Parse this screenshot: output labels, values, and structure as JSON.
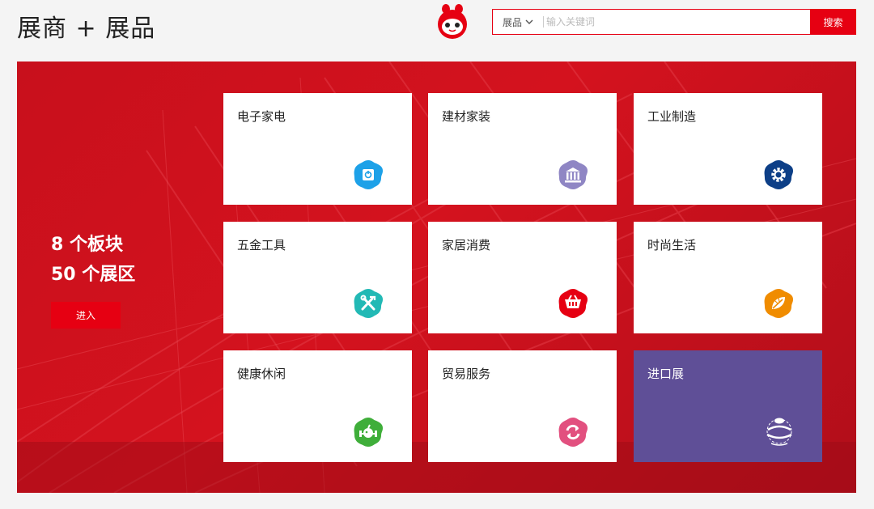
{
  "header": {
    "title": "展商 + 展品",
    "search": {
      "category": "展品",
      "placeholder": "输入关键词",
      "button_label": "搜索"
    }
  },
  "banner": {
    "stats_line1": "8 个板块",
    "stats_line2": "50 个展区",
    "enter_label": "进入"
  },
  "tiles": [
    {
      "label": "电子家电",
      "icon": "electronics-icon",
      "color": "#1da1e8"
    },
    {
      "label": "建材家装",
      "icon": "building-icon",
      "color": "#8f86c4"
    },
    {
      "label": "工业制造",
      "icon": "gear-icon",
      "color": "#0d3f87"
    },
    {
      "label": "五金工具",
      "icon": "tools-icon",
      "color": "#22b9b5"
    },
    {
      "label": "家居消费",
      "icon": "basket-icon",
      "color": "#e60012"
    },
    {
      "label": "时尚生活",
      "icon": "leaf-icon",
      "color": "#f08c00"
    },
    {
      "label": "健康休闲",
      "icon": "fitness-icon",
      "color": "#3fae3a"
    },
    {
      "label": "贸易服务",
      "icon": "exchange-icon",
      "color": "#e2507f"
    },
    {
      "label": "进口展",
      "icon": "international-pavilion-icon",
      "color": "#5f4f97"
    }
  ],
  "colors": {
    "accent": "#e60012",
    "banner": "#d4121e"
  }
}
